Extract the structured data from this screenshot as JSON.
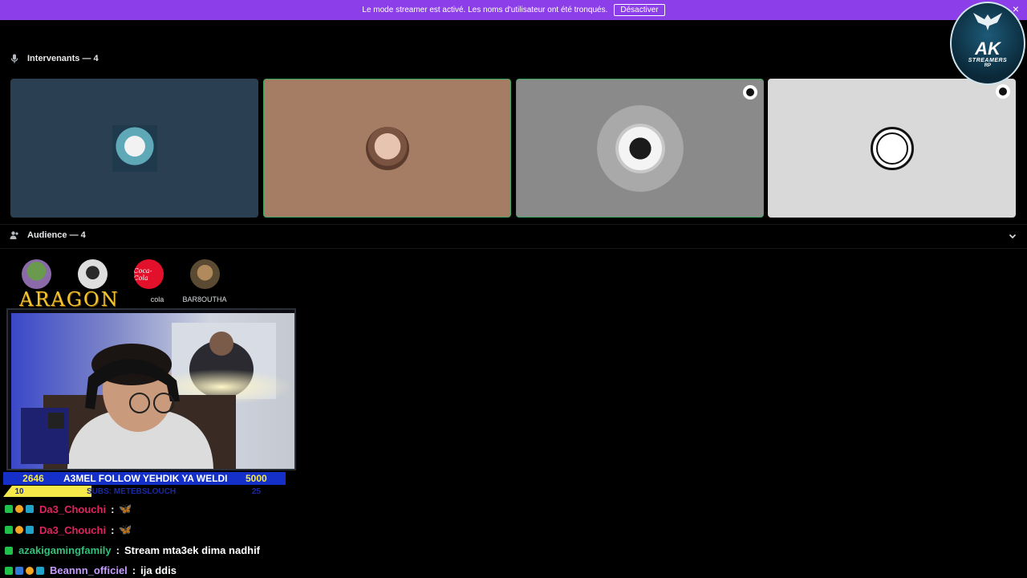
{
  "banner": {
    "text": "Le mode streamer est activé. Les noms d'utilisateur ont été tronqués.",
    "button": "Désactiver",
    "close": "×"
  },
  "speakers": {
    "title": "Intervenants — 4"
  },
  "audience": {
    "title": "Audience — 4",
    "members": [
      "",
      "",
      "cola",
      "BAR8OUTHA"
    ]
  },
  "logo": {
    "big": "AK",
    "small": "STREAMERS",
    "rp": "RP"
  },
  "overlay": {
    "channel": "ARAGON",
    "goal": {
      "left": "2646",
      "text": "A3MEL FOLLOW YEHDIK YA WELDI",
      "right": "5000"
    },
    "subs": {
      "left": "10",
      "text": "SUBS: METEBSLOUCH",
      "right": "25"
    }
  },
  "chat": [
    {
      "user": "Da3_Chouchi",
      "sep": ":",
      "msg": "🦋",
      "color": "#e0245e"
    },
    {
      "user": "Da3_Chouchi",
      "sep": ":",
      "msg": "🦋",
      "color": "#e0245e"
    },
    {
      "user": "azakigamingfamily",
      "sep": ":",
      "msg": "Stream mta3ek dima nadhif",
      "color": "#33c07a"
    },
    {
      "user": "Beannn_officiel",
      "sep": ":",
      "msg": "ija ddis",
      "color": "#c59bff"
    }
  ],
  "colors": {
    "banner": "#8c3fe8",
    "speaking": "#3ba55c",
    "goal_bar": "#1530c8",
    "goal_text": "#f5e94a"
  }
}
